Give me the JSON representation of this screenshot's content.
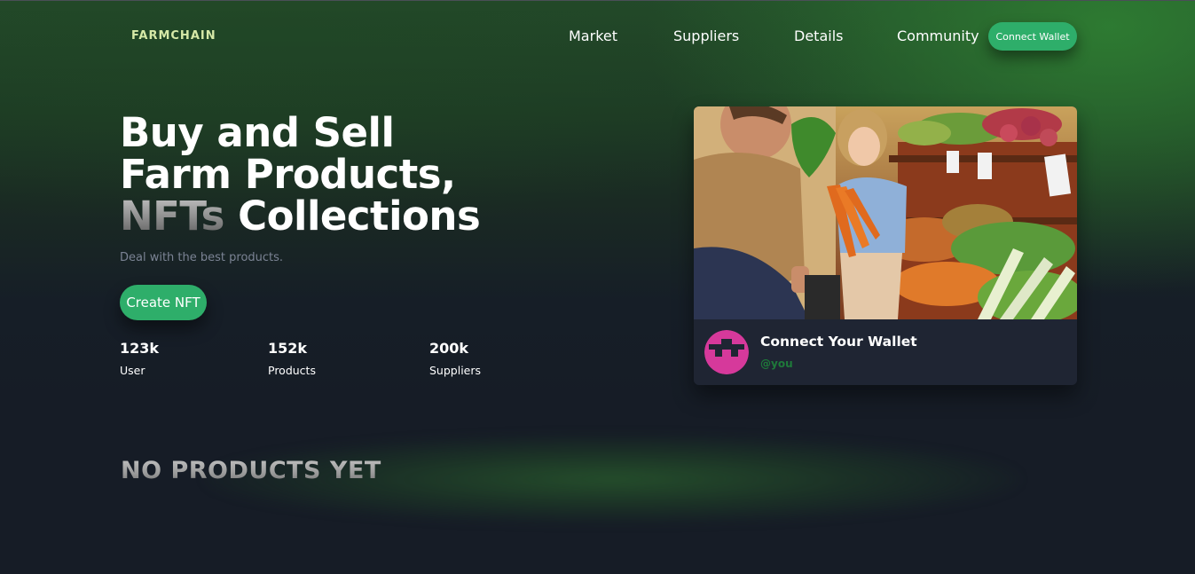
{
  "brand": {
    "logo_text": "FARMCHAIN"
  },
  "nav": {
    "links": [
      "Market",
      "Suppliers",
      "Details",
      "Community"
    ],
    "connect_wallet_label": "Connect Wallet"
  },
  "hero": {
    "headline_line1": "Buy and Sell",
    "headline_line2": "Farm Products,",
    "headline_line3_faded": "NFTs",
    "headline_line3_rest": " Collections",
    "subtitle": "Deal with the best products.",
    "create_button_label": "Create NFT",
    "stats": [
      {
        "value": "123k",
        "label": "User"
      },
      {
        "value": "152k",
        "label": "Products"
      },
      {
        "value": "200k",
        "label": "Suppliers"
      }
    ]
  },
  "card": {
    "title": "Connect Your Wallet",
    "handle": "@you",
    "avatar_icon": "identicon-avatar-icon",
    "image_description_icon": "farm-market-photo"
  },
  "products": {
    "empty_heading": "NO PRODUCTS YET"
  },
  "colors": {
    "accent_green": "#2eae6a",
    "logo_color": "#d6e9a7",
    "avatar_pink": "#d6399b",
    "handle_green": "#1e7a3a"
  }
}
